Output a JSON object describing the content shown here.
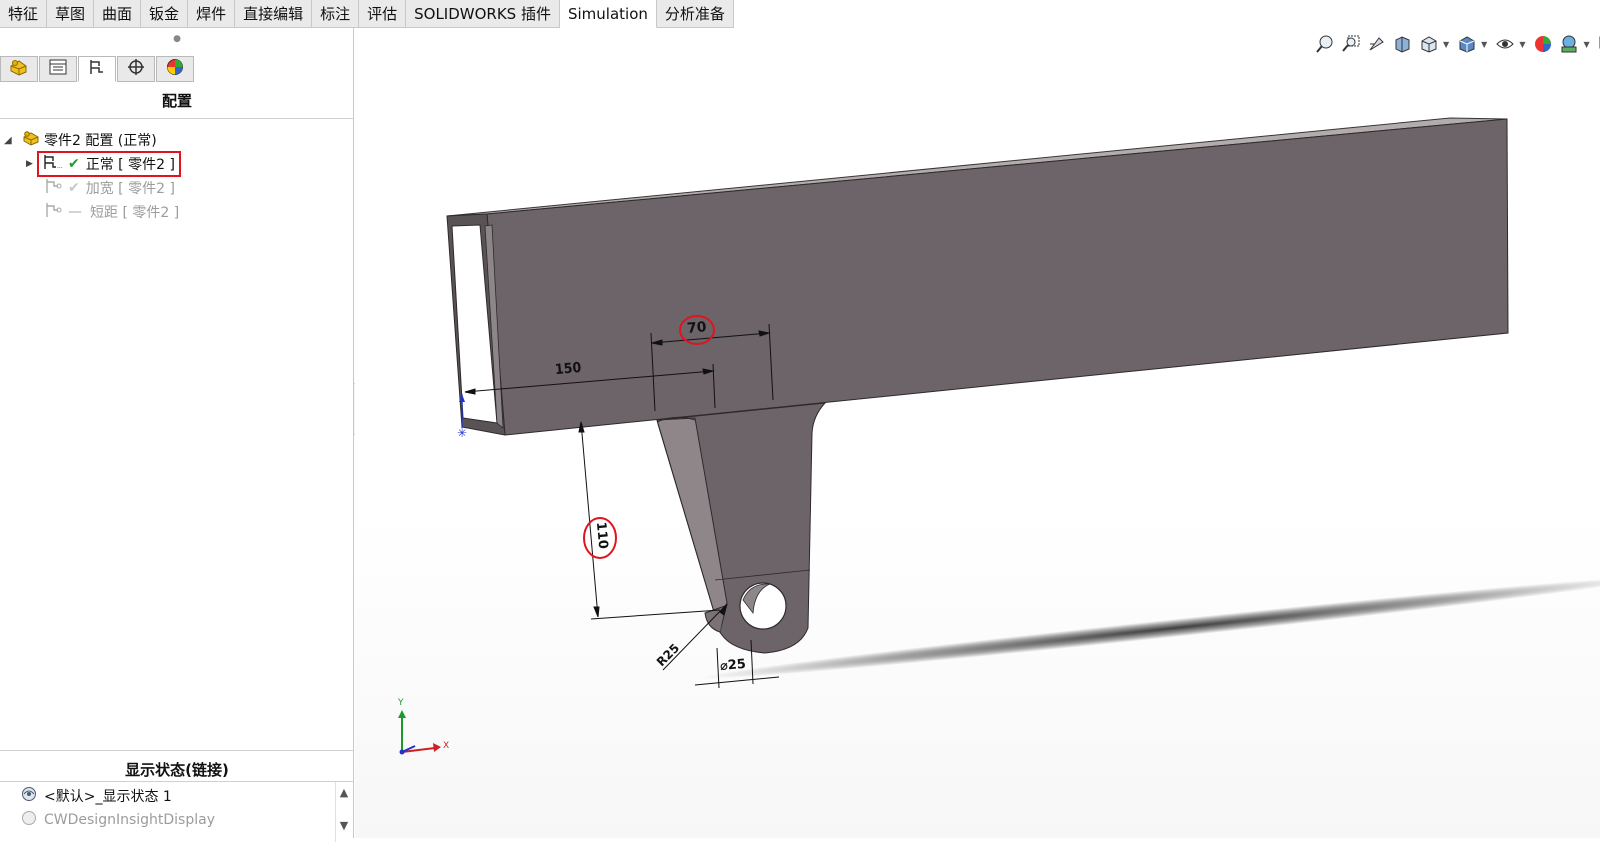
{
  "tabs": [
    {
      "label": "特征"
    },
    {
      "label": "草图"
    },
    {
      "label": "曲面"
    },
    {
      "label": "钣金"
    },
    {
      "label": "焊件"
    },
    {
      "label": "直接编辑"
    },
    {
      "label": "标注"
    },
    {
      "label": "评估"
    },
    {
      "label": "SOLIDWORKS 插件"
    },
    {
      "label": "Simulation"
    },
    {
      "label": "分析准备"
    }
  ],
  "panel_tabs": [
    "feature-manager-icon",
    "property-manager-icon",
    "configuration-manager-icon",
    "dimxpert-icon",
    "display-manager-icon"
  ],
  "panel": {
    "title": "配置",
    "tree": {
      "root": "零件2 配置 (正常)",
      "items": [
        {
          "label": "正常 [ 零件2 ]",
          "active": true
        },
        {
          "label": "加宽 [ 零件2 ]",
          "active": false
        },
        {
          "label": "短距 [ 零件2 ]",
          "active": false
        }
      ]
    }
  },
  "display_states": {
    "title": "显示状态(链接)",
    "items": [
      {
        "label": "<默认>_显示状态 1"
      },
      {
        "label": "CWDesignInsightDisplay"
      }
    ]
  },
  "viewport": {
    "dimensions": {
      "d150": "150",
      "d70": "70",
      "d110": "110",
      "r25": "R25",
      "dia25": "⌀25"
    },
    "axes": {
      "x": "X",
      "y": "Y"
    }
  },
  "colors": {
    "part_face": "#6c6468",
    "part_top": "#a9a3a3",
    "highlight_red": "#e0141e",
    "tab_bg": "#eaeaea",
    "check_green": "#1f9a2e"
  }
}
